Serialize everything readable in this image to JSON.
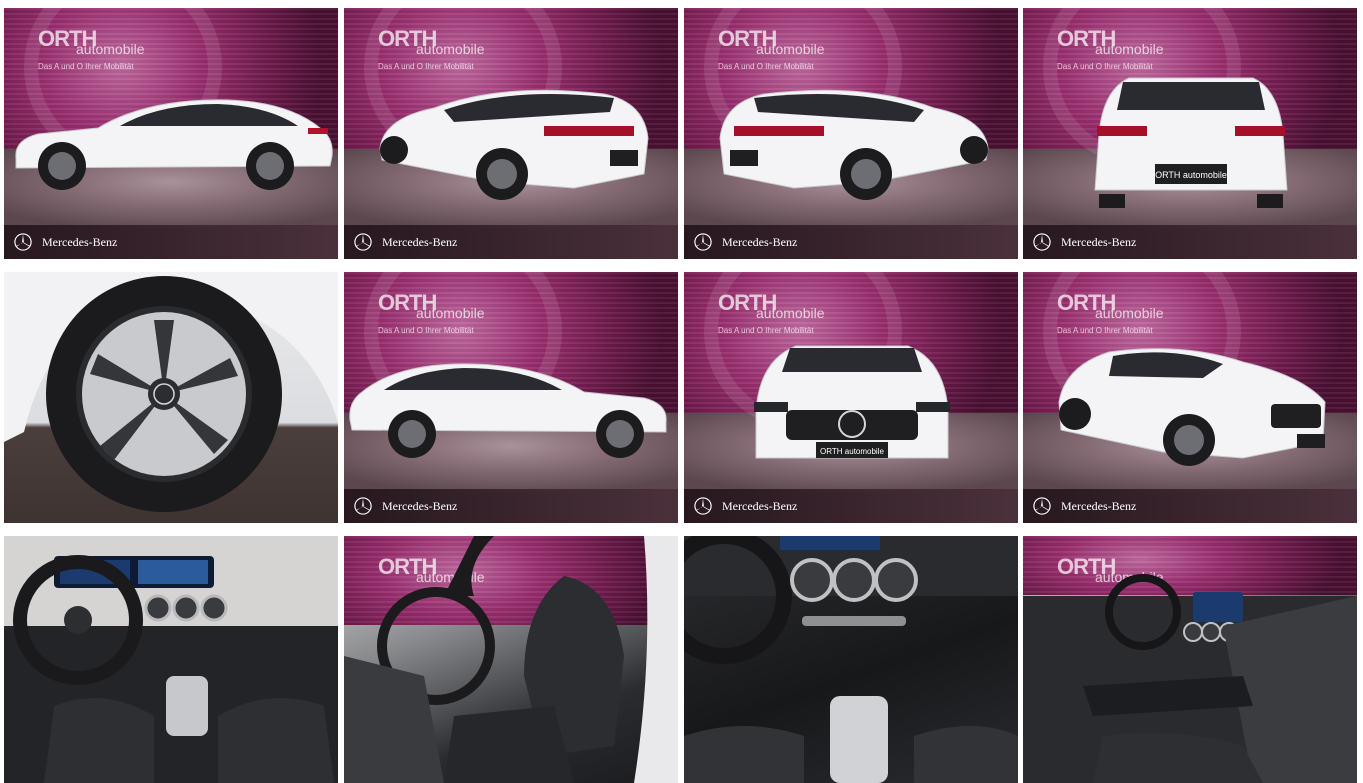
{
  "brand": {
    "dealer_logo": "ORTH",
    "dealer_logo_sub": "automobile",
    "dealer_slogan": "Das A und O Ihrer Mobilität",
    "make_label": "Mercedes-Benz",
    "plate_text": "ORTH automobile"
  },
  "colors": {
    "backdrop": "#9a2f70",
    "car_body": "#f4f4f6",
    "brandbar": "#2a1520"
  },
  "tiles": [
    {
      "id": "side-left",
      "kind": "studio",
      "view": "side profile left"
    },
    {
      "id": "rear-three-quarter-left",
      "kind": "studio",
      "view": "rear three-quarter left"
    },
    {
      "id": "rear-three-quarter-right",
      "kind": "studio",
      "view": "rear three-quarter right"
    },
    {
      "id": "rear",
      "kind": "studio",
      "view": "rear"
    },
    {
      "id": "wheel",
      "kind": "closeup",
      "view": "wheel close-up"
    },
    {
      "id": "side-right",
      "kind": "studio",
      "view": "side profile right"
    },
    {
      "id": "front",
      "kind": "studio",
      "view": "front"
    },
    {
      "id": "front-three-quarter-right",
      "kind": "studio",
      "view": "front three-quarter right"
    },
    {
      "id": "dashboard",
      "kind": "interior",
      "view": "dashboard"
    },
    {
      "id": "front-seats",
      "kind": "interior",
      "view": "front seats"
    },
    {
      "id": "center-console",
      "kind": "interior",
      "view": "center console"
    },
    {
      "id": "cockpit-side",
      "kind": "interior",
      "view": "cockpit side view"
    }
  ]
}
